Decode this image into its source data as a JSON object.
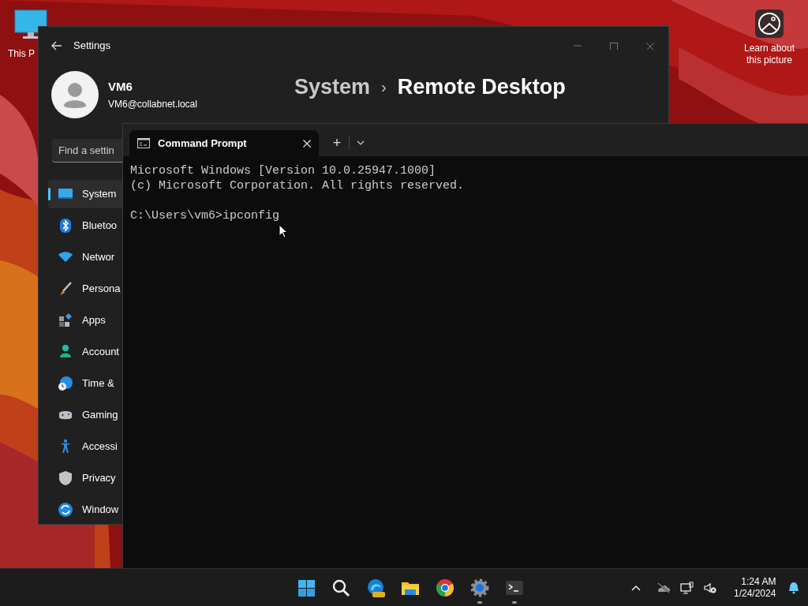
{
  "desktop": {
    "icons": [
      {
        "label": "This P"
      }
    ],
    "spotlight": {
      "label": "Learn about this picture"
    }
  },
  "settings": {
    "title": "Settings",
    "profile": {
      "name": "VM6",
      "email": "VM6@collabnet.local"
    },
    "search": {
      "placeholder": "Find a settin"
    },
    "breadcrumb": {
      "parent": "System",
      "separator": "›",
      "current": "Remote Desktop"
    },
    "nav": [
      {
        "label": "System",
        "selected": true
      },
      {
        "label": "Bluetoo",
        "selected": false
      },
      {
        "label": "Networ",
        "selected": false
      },
      {
        "label": "Persona",
        "selected": false
      },
      {
        "label": "Apps",
        "selected": false
      },
      {
        "label": "Account",
        "selected": false
      },
      {
        "label": "Time &",
        "selected": false
      },
      {
        "label": "Gaming",
        "selected": false
      },
      {
        "label": "Accessi",
        "selected": false
      },
      {
        "label": "Privacy",
        "selected": false
      },
      {
        "label": "Window",
        "selected": false
      }
    ]
  },
  "terminal": {
    "tab": {
      "title": "Command Prompt"
    },
    "new_tab": "+",
    "lines": [
      "Microsoft Windows [Version 10.0.25947.1000]",
      "(c) Microsoft Corporation. All rights reserved."
    ],
    "prompt": "C:\\Users\\vm6>ipconfig"
  },
  "taskbar": {
    "apps": [
      {
        "running": false
      },
      {
        "running": false
      },
      {
        "running": false
      },
      {
        "running": false
      },
      {
        "running": false
      },
      {
        "running": true
      },
      {
        "running": true
      }
    ],
    "time": "1:24 AM",
    "date": "1/24/2024"
  }
}
